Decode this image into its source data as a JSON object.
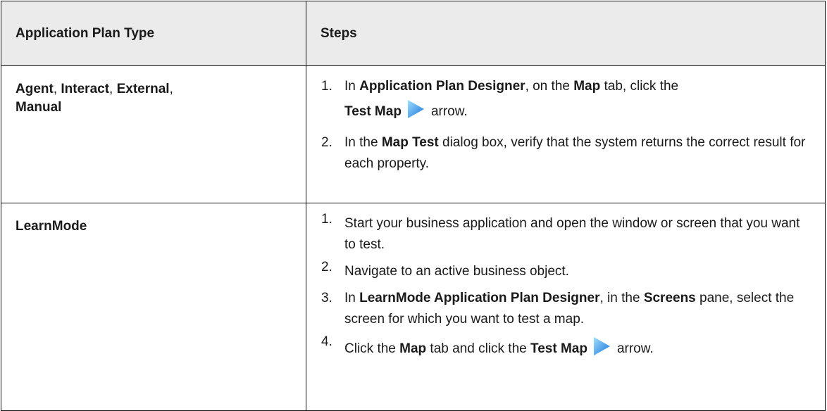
{
  "table": {
    "headers": [
      "Application Plan Type",
      "Steps"
    ],
    "rows": [
      {
        "types": [
          "Agent",
          "Interact",
          "External",
          "Manual"
        ],
        "steps": [
          {
            "num": "1.",
            "text_1": "In ",
            "bold_1": "Application Plan Designer",
            "text_2": ", on the ",
            "bold_2": "Map",
            "text_3": " tab, click the",
            "bold_3": "Test Map",
            "icon": "play-arrow-icon",
            "text_4": "arrow."
          },
          {
            "num": "2.",
            "text_1": "In the ",
            "bold_1": "Map Test",
            "text_2": " dialog box, verify that the system returns the correct result for each property."
          }
        ]
      },
      {
        "types": [
          "LearnMode"
        ],
        "steps": [
          {
            "num": "1.",
            "text_1": "Start your business application and open the window or screen that you want to test."
          },
          {
            "num": "2.",
            "text_1": "Navigate to an active business object."
          },
          {
            "num": "3.",
            "text_1": "In ",
            "bold_1": "LearnMode Application Plan Designer",
            "text_2": ", in the ",
            "bold_2": "Screens",
            "text_3": " pane, select the screen for which you want to test a map."
          },
          {
            "num": "4.",
            "text_1": "Click the ",
            "bold_1": "Map",
            "text_2": " tab and click the ",
            "bold_2": "Test Map",
            "icon": "play-arrow-icon",
            "text_3": "arrow."
          }
        ]
      }
    ]
  },
  "colors": {
    "header_bg": "#ebebeb",
    "border": "#111111",
    "icon_light": "#7fd0ff",
    "icon_dark": "#1a73d9"
  }
}
